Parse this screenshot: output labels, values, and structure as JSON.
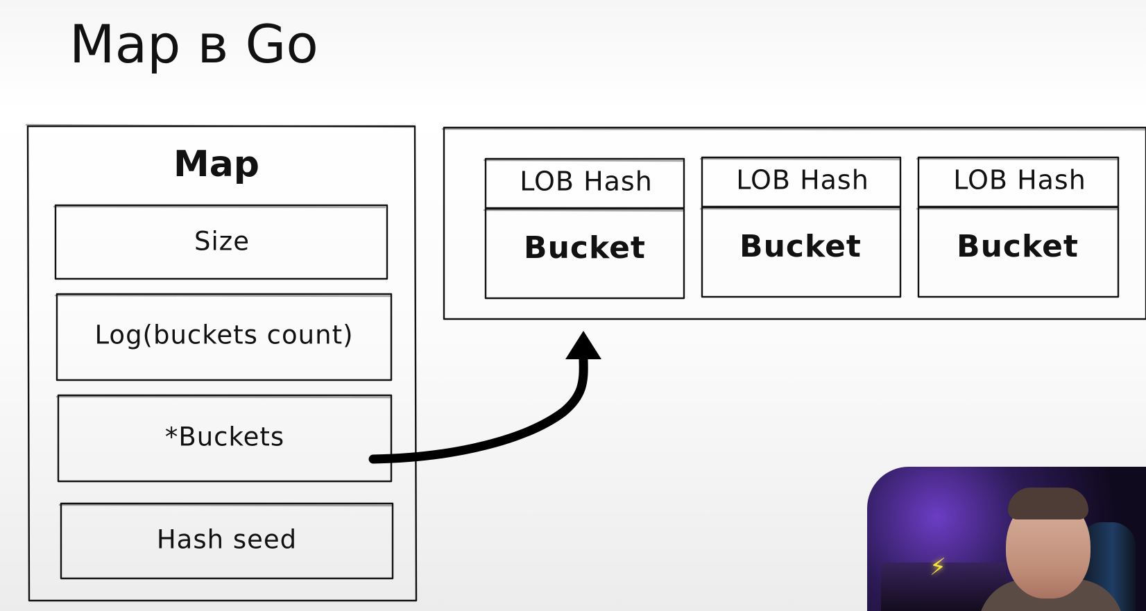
{
  "slide": {
    "title": "Map в Go"
  },
  "map_struct": {
    "title": "Map",
    "fields": [
      "Size",
      "Log(buckets count)",
      "*Buckets",
      "Hash seed"
    ]
  },
  "buckets": [
    {
      "header": "LOB Hash",
      "label": "Bucket"
    },
    {
      "header": "LOB Hash",
      "label": "Bucket"
    },
    {
      "header": "LOB Hash",
      "label": "Bucket"
    }
  ],
  "colors": {
    "stroke": "#111111",
    "background": "#ffffff"
  }
}
